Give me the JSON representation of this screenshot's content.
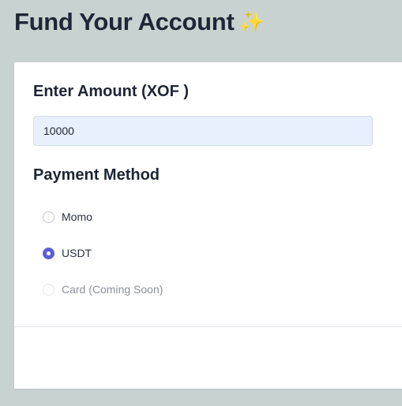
{
  "page": {
    "title": "Fund Your Account",
    "title_emoji": "✨"
  },
  "amount": {
    "label": "Enter Amount (XOF )",
    "value": "10000"
  },
  "payment": {
    "label": "Payment Method",
    "options": [
      {
        "label": "Momo",
        "selected": false,
        "disabled": false
      },
      {
        "label": "USDT",
        "selected": true,
        "disabled": false
      },
      {
        "label": "Card (Coming Soon)",
        "selected": false,
        "disabled": true
      }
    ]
  },
  "colors": {
    "page_bg": "#c8d3d1",
    "accent": "#5b5fd6",
    "input_bg": "#e9f0fd"
  }
}
